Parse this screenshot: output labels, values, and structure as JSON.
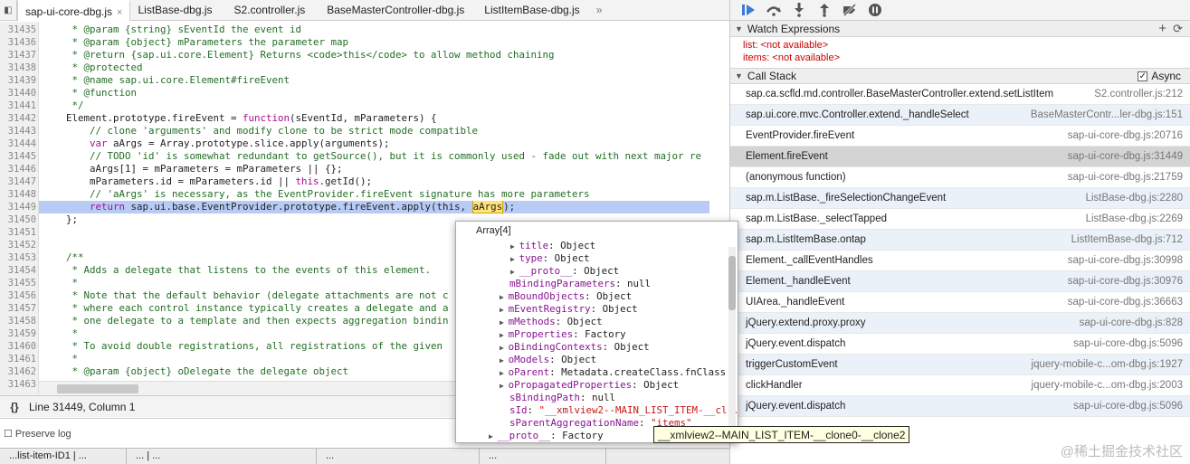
{
  "tabs": [
    {
      "label": "sap-ui-core-dbg.js",
      "active": true
    },
    {
      "label": "ListBase-dbg.js"
    },
    {
      "label": "S2.controller.js"
    },
    {
      "label": "BaseMasterController-dbg.js"
    },
    {
      "label": "ListItemBase-dbg.js"
    },
    {
      "label": "»"
    }
  ],
  "close_glyph": "×",
  "code": {
    "lines": [
      {
        "n": "31435",
        "t": "     * @param {string} sEventId the event id"
      },
      {
        "n": "31436",
        "t": "     * @param {object} mParameters the parameter map"
      },
      {
        "n": "31437",
        "t": "     * @return {sap.ui.core.Element} Returns <code>this</code> to allow method chaining"
      },
      {
        "n": "31438",
        "t": "     * @protected"
      },
      {
        "n": "31439",
        "t": "     * @name sap.ui.core.Element#fireEvent"
      },
      {
        "n": "31440",
        "t": "     * @function"
      },
      {
        "n": "31441",
        "t": "     */"
      },
      {
        "n": "31442",
        "t": "    Element.prototype.fireEvent = function(sEventId, mParameters) {"
      },
      {
        "n": "31443",
        "t": "        // clone 'arguments' and modify clone to be strict mode compatible"
      },
      {
        "n": "31444",
        "t": "        var aArgs = Array.prototype.slice.apply(arguments);"
      },
      {
        "n": "31445",
        "t": "        // TODO 'id' is somewhat redundant to getSource(), but it is commonly used - fade out with next major re"
      },
      {
        "n": "31446",
        "t": "        aArgs[1] = mParameters = mParameters || {};"
      },
      {
        "n": "31447",
        "t": "        mParameters.id = mParameters.id || this.getId();"
      },
      {
        "n": "31448",
        "t": "        // 'aArgs' is necessary, as the EventProvider.fireEvent signature has more parameters"
      },
      {
        "n": "31449",
        "t": "        return sap.ui.base.EventProvider.prototype.fireEvent.apply(this, aArgs);"
      },
      {
        "n": "31450",
        "t": "    };"
      },
      {
        "n": "31451",
        "t": ""
      },
      {
        "n": "31452",
        "t": ""
      },
      {
        "n": "31453",
        "t": "    /**"
      },
      {
        "n": "31454",
        "t": "     * Adds a delegate that listens to the events of this element."
      },
      {
        "n": "31455",
        "t": "     *"
      },
      {
        "n": "31456",
        "t": "     * Note that the default behavior (delegate attachments are not c"
      },
      {
        "n": "31457",
        "t": "     * where each control instance typically creates a delegate and a"
      },
      {
        "n": "31458",
        "t": "     * one delegate to a template and then expects aggregation bindin"
      },
      {
        "n": "31459",
        "t": "     *"
      },
      {
        "n": "31460",
        "t": "     * To avoid double registrations, all registrations of the given"
      },
      {
        "n": "31461",
        "t": "     *"
      },
      {
        "n": "31462",
        "t": "     * @param {object} oDelegate the delegate object"
      },
      {
        "n": "31463",
        "t": ""
      }
    ]
  },
  "status": {
    "brace": "{}",
    "position": "Line 31449, Column 1"
  },
  "bottom": {
    "preserve_log": "Preserve log",
    "tabs": [
      "...list-item-ID1 | ...",
      "... | ...",
      "...",
      "..."
    ]
  },
  "debugger": {
    "controls": [
      "resume-icon",
      "step-over-icon",
      "step-into-icon",
      "step-out-icon",
      "deactivate-breakpoints-icon",
      "pause-on-exceptions-icon"
    ],
    "watch_title": "Watch Expressions",
    "watch_add": "+",
    "watch_refresh": "⟳",
    "watch": [
      {
        "name": "list",
        "value": "<not available>"
      },
      {
        "name": "items",
        "value": "<not available>"
      }
    ],
    "callstack_title": "Call Stack",
    "async_label": "Async",
    "async_checked": true,
    "frames": [
      {
        "fn": "sap.ca.scfld.md.controller.BaseMasterController.extend.setListItem",
        "loc": "S2.controller.js:212"
      },
      {
        "fn": "sap.ui.core.mvc.Controller.extend._handleSelect",
        "loc": "BaseMasterContr...ler-dbg.js:151"
      },
      {
        "fn": "EventProvider.fireEvent",
        "loc": "sap-ui-core-dbg.js:20716"
      },
      {
        "fn": "Element.fireEvent",
        "loc": "sap-ui-core-dbg.js:31449",
        "selected": true
      },
      {
        "fn": "(anonymous function)",
        "loc": "sap-ui-core-dbg.js:21759"
      },
      {
        "fn": "sap.m.ListBase._fireSelectionChangeEvent",
        "loc": "ListBase-dbg.js:2280"
      },
      {
        "fn": "sap.m.ListBase._selectTapped",
        "loc": "ListBase-dbg.js:2269"
      },
      {
        "fn": "sap.m.ListItemBase.ontap",
        "loc": "ListItemBase-dbg.js:712"
      },
      {
        "fn": "Element._callEventHandles",
        "loc": "sap-ui-core-dbg.js:30998"
      },
      {
        "fn": "Element._handleEvent",
        "loc": "sap-ui-core-dbg.js:30976"
      },
      {
        "fn": "UIArea._handleEvent",
        "loc": "sap-ui-core-dbg.js:36663"
      },
      {
        "fn": "jQuery.extend.proxy.proxy",
        "loc": "sap-ui-core-dbg.js:828"
      },
      {
        "fn": "jQuery.event.dispatch",
        "loc": "sap-ui-core-dbg.js:5096"
      },
      {
        "fn": "triggerCustomEvent",
        "loc": "jquery-mobile-c...om-dbg.js:1927"
      },
      {
        "fn": "clickHandler",
        "loc": "jquery-mobile-c...om-dbg.js:2003"
      },
      {
        "fn": "jQuery.event.dispatch",
        "loc": "sap-ui-core-dbg.js:5096"
      }
    ]
  },
  "popover": {
    "title": "Array[4]",
    "rows": [
      {
        "indent": 2,
        "arrow": true,
        "name": "title",
        "value": "Object"
      },
      {
        "indent": 2,
        "arrow": true,
        "name": "type",
        "value": "Object"
      },
      {
        "indent": 2,
        "arrow": true,
        "name": "__proto__",
        "value": "Object"
      },
      {
        "indent": 1,
        "arrow": false,
        "name": "mBindingParameters",
        "value": "null"
      },
      {
        "indent": 1,
        "arrow": true,
        "name": "mBoundObjects",
        "value": "Object"
      },
      {
        "indent": 1,
        "arrow": true,
        "name": "mEventRegistry",
        "value": "Object"
      },
      {
        "indent": 1,
        "arrow": true,
        "name": "mMethods",
        "value": "Object"
      },
      {
        "indent": 1,
        "arrow": true,
        "name": "mProperties",
        "value": "Factory"
      },
      {
        "indent": 1,
        "arrow": true,
        "name": "oBindingContexts",
        "value": "Object"
      },
      {
        "indent": 1,
        "arrow": true,
        "name": "oModels",
        "value": "Object"
      },
      {
        "indent": 1,
        "arrow": true,
        "name": "oParent",
        "value": "Metadata.createClass.fnClass"
      },
      {
        "indent": 1,
        "arrow": true,
        "name": "oPropagatedProperties",
        "value": "Object"
      },
      {
        "indent": 1,
        "arrow": false,
        "name": "sBindingPath",
        "value": "null"
      },
      {
        "indent": 1,
        "arrow": false,
        "name": "sId",
        "value": "\"__xmlview2--MAIN_LIST_ITEM-__cl...",
        "str": true
      },
      {
        "indent": 1,
        "arrow": false,
        "name": "sParentAggregationName",
        "value": "\"items\"",
        "str": true
      },
      {
        "indent": 0,
        "arrow": true,
        "name": "__proto__",
        "value": "Factory"
      }
    ]
  },
  "tooltip": "__xmlview2--MAIN_LIST_ITEM-__clone0-__clone2",
  "watermark": "@稀土掘金技术社区"
}
